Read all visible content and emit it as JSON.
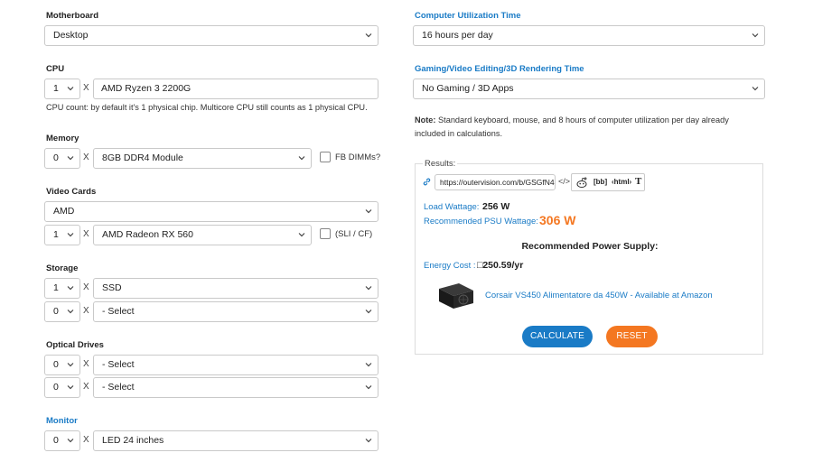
{
  "left": {
    "motherboard": {
      "label": "Motherboard",
      "value": "Desktop"
    },
    "cpu": {
      "label": "CPU",
      "count": "1",
      "x": "X",
      "model": "AMD Ryzen 3 2200G",
      "note": "CPU count: by default it's 1 physical chip. Multicore CPU still counts as 1 physical CPU."
    },
    "memory": {
      "label": "Memory",
      "count": "0",
      "x": "X",
      "module": "8GB DDR4 Module",
      "fb_label": "FB DIMMs?"
    },
    "video": {
      "label": "Video Cards",
      "brand": "AMD",
      "count": "1",
      "x": "X",
      "model": "AMD Radeon RX 560",
      "sli_label": "(SLI / CF)"
    },
    "storage": {
      "label": "Storage",
      "rows": [
        {
          "count": "1",
          "x": "X",
          "value": "SSD"
        },
        {
          "count": "0",
          "x": "X",
          "value": "- Select"
        }
      ]
    },
    "optical": {
      "label": "Optical Drives",
      "rows": [
        {
          "count": "0",
          "x": "X",
          "value": "- Select"
        },
        {
          "count": "0",
          "x": "X",
          "value": "- Select"
        }
      ]
    },
    "monitor": {
      "label": "Monitor",
      "count": "0",
      "x": "X",
      "value": "LED 24 inches"
    }
  },
  "right": {
    "utilization": {
      "label": "Computer Utilization Time",
      "value": "16 hours per day"
    },
    "gaming": {
      "label": "Gaming/Video Editing/3D Rendering Time",
      "value": "No Gaming / 3D Apps"
    },
    "note_bold": "Note:",
    "note_text": " Standard keyboard, mouse, and 8 hours of computer utilization per day already included in calculations.",
    "results": {
      "title": "Results:",
      "share_url": "https://outervision.com/b/GSGfN4",
      "embed_icon_text": "</>",
      "bb_text": "[bb]",
      "html_text": "‹html›",
      "t_text": "T",
      "load_label": "Load Wattage:",
      "load_value": "256 W",
      "psu_label": "Recommended PSU Wattage:",
      "psu_value": "306 W",
      "rec_supply": "Recommended Power Supply:",
      "energy_label": "Energy Cost :",
      "energy_value": "□250.59/yr",
      "product": "Corsair VS450 Alimentatore da 450W - Available at Amazon",
      "calculate": "CALCULATE",
      "reset": "RESET"
    }
  },
  "colors": {
    "accent_blue": "#1a7bc6",
    "orange": "#f47721",
    "calc_button": "#1a7bc6",
    "reset_button": "#f47721"
  }
}
